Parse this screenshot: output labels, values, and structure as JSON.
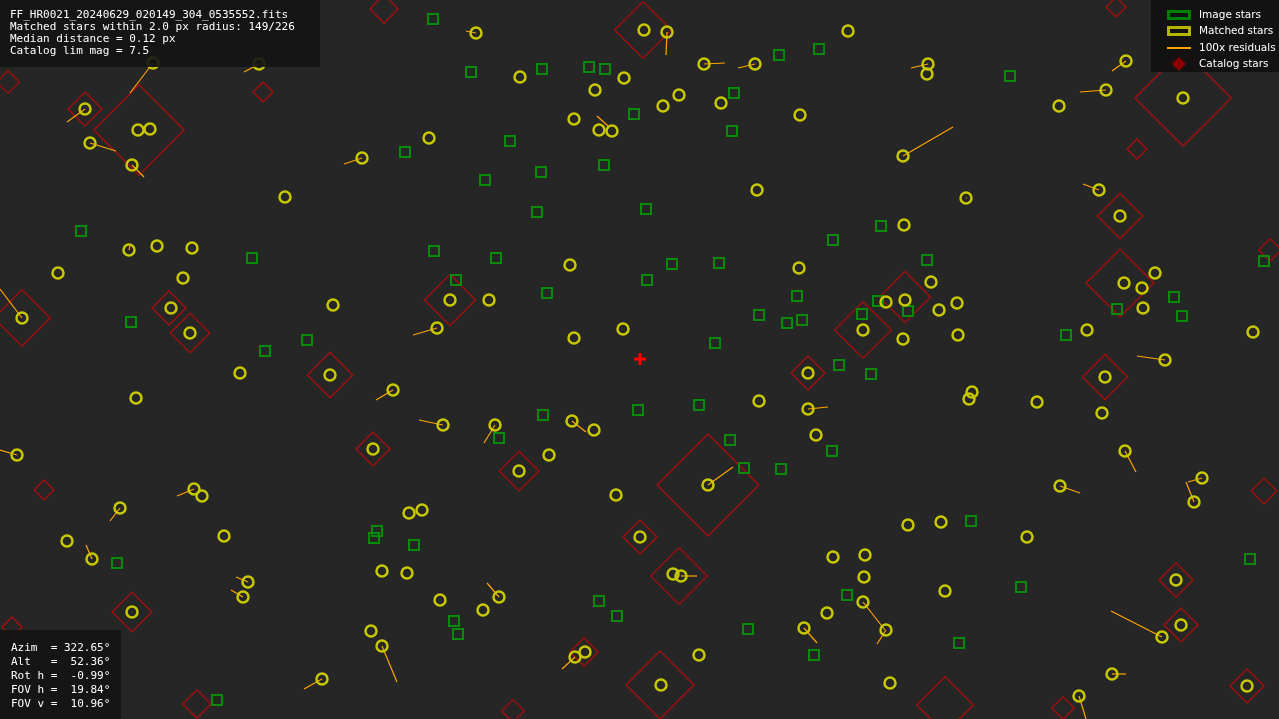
{
  "header_lines": [
    "FF_HR0021_20240629_020149_304_0535552.fits",
    "Matched stars within 2.0 px radius: 149/226",
    "Median distance = 0.12 px",
    "Catalog lim mag = 7.5"
  ],
  "legend": [
    {
      "kind": "box",
      "color": "#008000",
      "label": "Image stars"
    },
    {
      "kind": "box",
      "color": "#b5b500",
      "label": "Matched stars"
    },
    {
      "kind": "line",
      "color": "#ffa500",
      "label": "100x residuals"
    },
    {
      "kind": "diamond",
      "color": "#8b0000",
      "label": "Catalog stars"
    }
  ],
  "pointing_lines": [
    "Azim  = 322.65°",
    "Alt   =  52.36°",
    "Rot h =  -0.99°",
    "FOV h =  19.84°",
    "FOV v =  10.96°"
  ]
}
